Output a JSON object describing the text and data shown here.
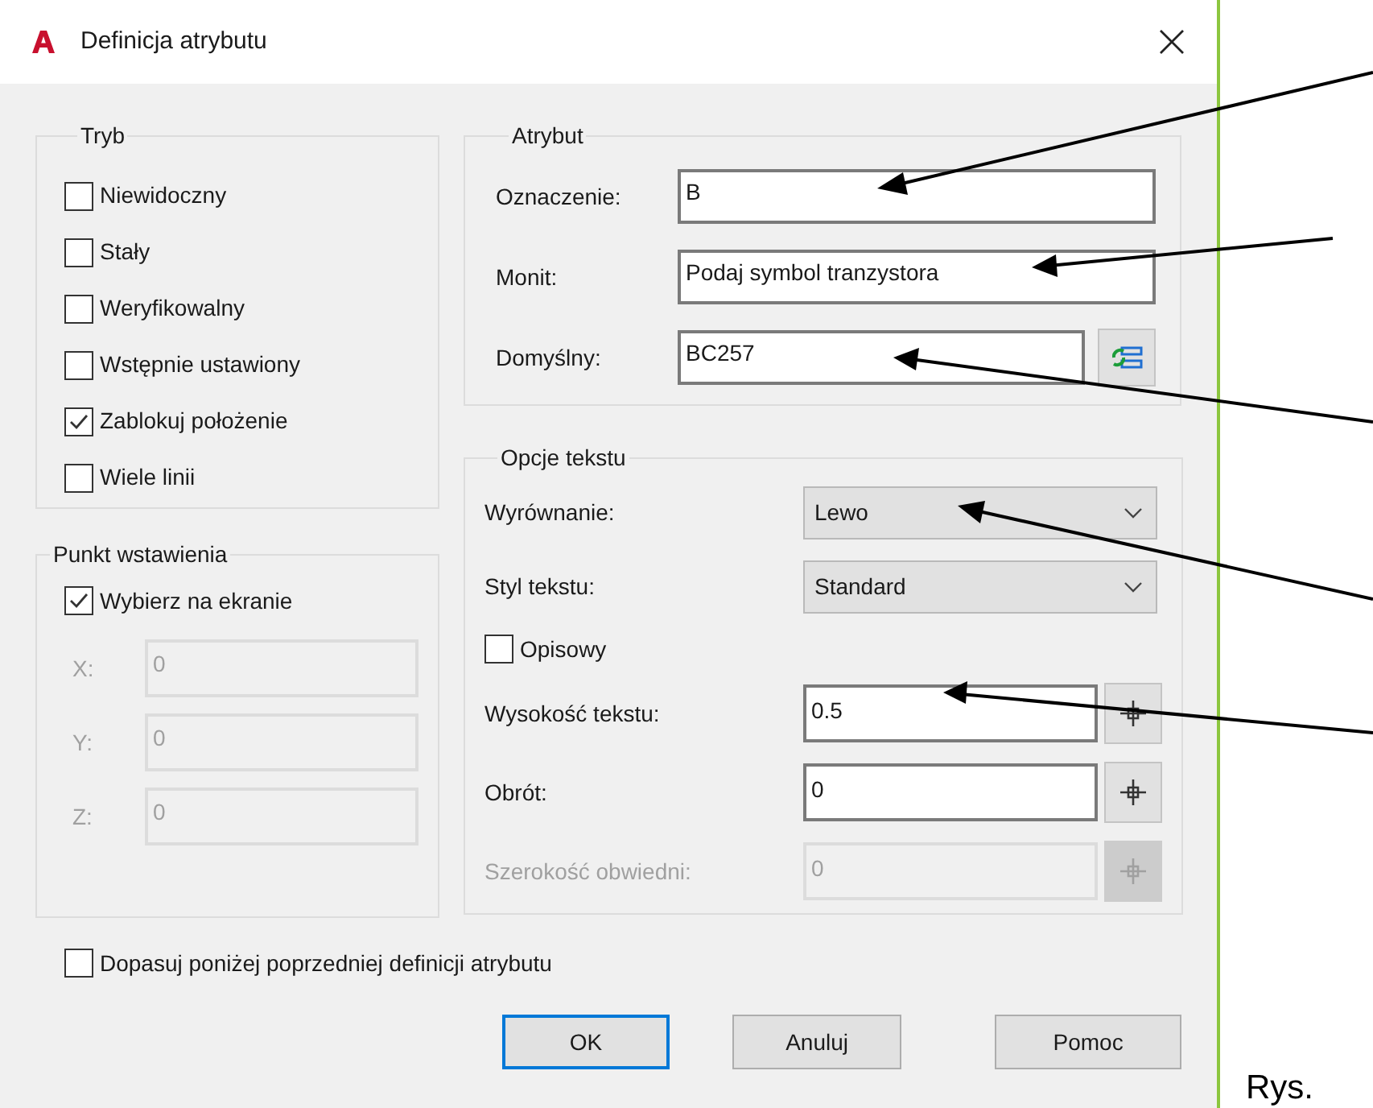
{
  "window": {
    "title": "Definicja atrybutu"
  },
  "mode": {
    "title": "Tryb",
    "options": [
      {
        "label": "Niewidoczny",
        "checked": false
      },
      {
        "label": "Stały",
        "checked": false
      },
      {
        "label": "Weryfikowalny",
        "checked": false
      },
      {
        "label": "Wstępnie ustawiony",
        "checked": false
      },
      {
        "label": "Zablokuj położenie",
        "checked": true
      },
      {
        "label": "Wiele linii",
        "checked": false
      }
    ]
  },
  "insertion_point": {
    "title": "Punkt wstawienia",
    "pick": {
      "label": "Wybierz na ekranie",
      "checked": true
    },
    "coords": [
      {
        "label": "X:",
        "value": "0",
        "disabled": true
      },
      {
        "label": "Y:",
        "value": "0",
        "disabled": true
      },
      {
        "label": "Z:",
        "value": "0",
        "disabled": true
      }
    ]
  },
  "attribute": {
    "title": "Atrybut",
    "fields": [
      {
        "kind": "text",
        "label": "Oznaczenie:",
        "value": "B"
      },
      {
        "kind": "text",
        "label": "Monit:",
        "value": "Podaj symbol tranzystora"
      },
      {
        "kind": "field_button",
        "label": "Domyślny:",
        "value": "BC257"
      }
    ]
  },
  "text_options": {
    "title": "Opcje tekstu",
    "rows": [
      {
        "kind": "select",
        "label": "Wyrównanie:",
        "value": "Lewo"
      },
      {
        "kind": "select",
        "label": "Styl tekstu:",
        "value": "Standard"
      },
      {
        "kind": "checkbox",
        "label": "Opisowy",
        "checked": false
      },
      {
        "kind": "pick",
        "label": "Wysokość tekstu:",
        "value": "0.5",
        "disabled": false
      },
      {
        "kind": "pick",
        "label": "Obrót:",
        "value": "0",
        "disabled": false
      },
      {
        "kind": "pick",
        "label": "Szerokość obwiedni:",
        "value": "0",
        "disabled": true
      }
    ]
  },
  "align_below": {
    "label": "Dopasuj poniżej poprzedniej definicji atrybutu",
    "checked": false
  },
  "buttons": [
    {
      "label": "OK",
      "default": true
    },
    {
      "label": "Anuluj",
      "default": false
    },
    {
      "label": "Pomoc",
      "default": false
    }
  ],
  "caption": "Rys."
}
